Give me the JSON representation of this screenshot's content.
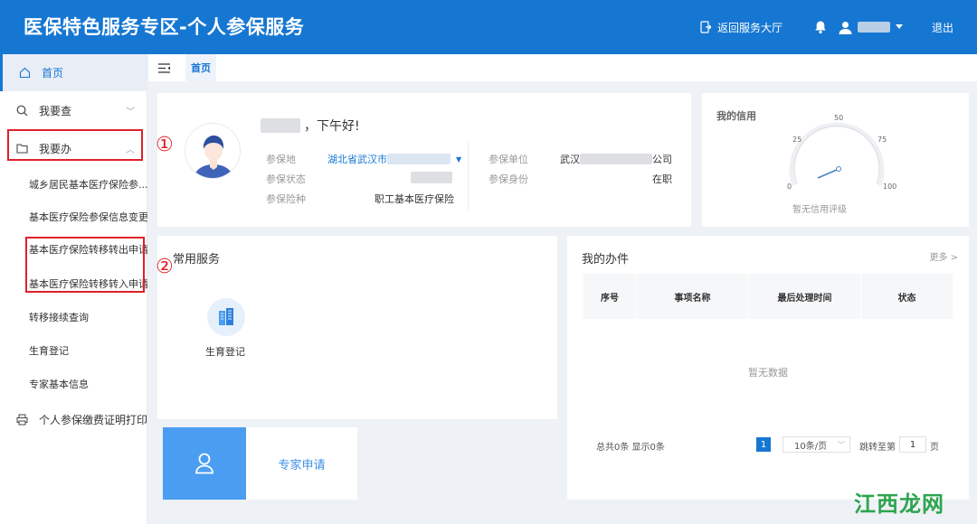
{
  "header": {
    "title": "医保特色服务专区-个人参保服务",
    "back_label": "返回服务大厅",
    "logout_label": "退出"
  },
  "sidebar": {
    "home": "首页",
    "query": "我要查",
    "handle": "我要办",
    "sub_items": [
      "城乡居民基本医疗保险参...",
      "基本医疗保险参保信息变更",
      "基本医疗保险转移转出申请",
      "基本医疗保险转移转入申请",
      "转移接续查询",
      "生育登记",
      "专家基本信息"
    ],
    "print": "个人参保缴费证明打印"
  },
  "tabs": {
    "home": "首页"
  },
  "profile": {
    "greeting": "，下午好!",
    "labels": {
      "insured_place": "参保地",
      "insured_status": "参保状态",
      "insurance_type": "参保险种",
      "insured_unit": "参保单位",
      "insured_identity": "参保身份"
    },
    "values": {
      "insured_place": "湖北省武汉市",
      "insurance_type": "职工基本医疗保险",
      "unit_prefix": "武汉",
      "unit_suffix": "公司",
      "identity": "在职"
    }
  },
  "credit": {
    "title": "我的信用",
    "ticks": [
      "0",
      "25",
      "50",
      "75",
      "100"
    ],
    "no_rating": "暂无信用评级"
  },
  "common_services": {
    "title": "常用服务",
    "items": [
      "生育登记"
    ]
  },
  "expert": {
    "label": "专家申请"
  },
  "tasks": {
    "title": "我的办件",
    "more": "更多 >",
    "columns": [
      "序号",
      "事项名称",
      "最后处理时间",
      "状态"
    ],
    "empty": "暂无数据",
    "pagination": {
      "total": "总共0条 显示0条",
      "current_page": "1",
      "page_size": "10条/页",
      "jump_label": "跳转至第",
      "jump_value": "1",
      "page_suffix": "页"
    }
  },
  "annotations": [
    "①",
    "②"
  ],
  "watermark": "江西龙网",
  "colors": {
    "primary": "#1677d2",
    "highlight": "#e0202a",
    "expert": "#4a9df0"
  }
}
